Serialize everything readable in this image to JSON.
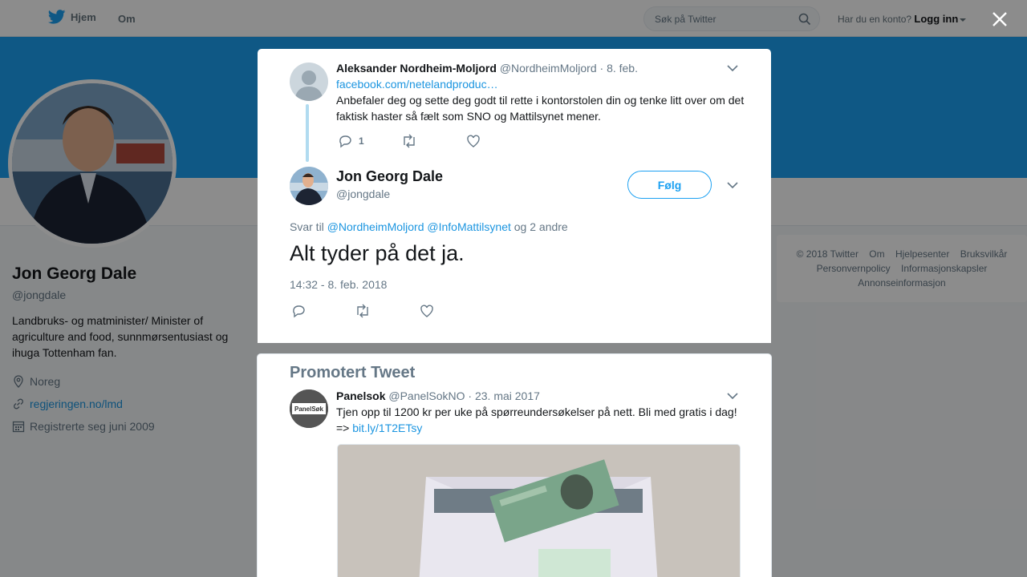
{
  "topbar": {
    "home_label": "Hjem",
    "about_label": "Om",
    "search_placeholder": "Søk på Twitter",
    "account_prompt": "Har du en konto?",
    "login_label": "Logg inn"
  },
  "profile": {
    "name": "Jon Georg Dale",
    "handle": "@jongdale",
    "bio": "Landbruks- og matminister/ Minister of agriculture and food, sunnmørsentusiast og ihuga Tottenham fan.",
    "location": "Noreg",
    "website": "regjeringen.no/lmd",
    "joined": "Registrerte seg juni 2009"
  },
  "footer_links": [
    "© 2018 Twitter",
    "Om",
    "Hjelpesenter",
    "Bruksvilkår",
    "Personvernpolicy",
    "Informasjonskapsler",
    "Annonseinformasjon"
  ],
  "parent_tweet": {
    "name": "Aleksander Nordheim-Moljord",
    "handle": "@NordheimMoljord",
    "date": "· 8. feb.",
    "link": "facebook.com/netelandproduc…",
    "text": "Anbefaler deg og sette deg godt til rette i kontorstolen din og tenke litt over om det faktisk haster så fælt som SNO og Mattilsynet mener.",
    "reply_count": "1"
  },
  "focused_tweet": {
    "name": "Jon Georg Dale",
    "handle": "@jongdale",
    "follow_label": "Følg",
    "reply_prefix": "Svar til",
    "reply_mention_1": "@NordheimMoljord",
    "reply_mention_2": "@InfoMattilsynet",
    "reply_suffix": "og 2 andre",
    "text": "Alt tyder på det ja.",
    "timestamp": "14:32 - 8. feb. 2018"
  },
  "promoted": {
    "title": "Promotert Tweet",
    "name": "Panelsok",
    "handle": "@PanelSokNO",
    "date": "· 23. mai 2017",
    "text": "Tjen opp til 1200 kr per uke på spørreundersøkelser på nett. Bli med gratis i dag!",
    "text_prefix": "=>",
    "link": "bit.ly/1T2ETsy",
    "logo_text": "PanelSøk"
  },
  "colors": {
    "accent": "#1da1f2",
    "link": "#1b95e0",
    "muted": "#657786"
  }
}
